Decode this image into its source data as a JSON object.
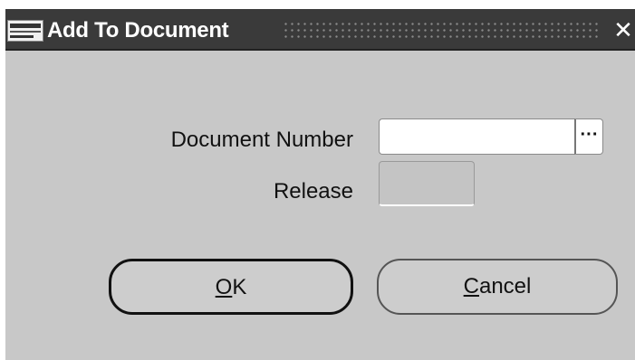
{
  "window": {
    "title": "Add To Document",
    "close_glyph": "✕"
  },
  "form": {
    "document_number_label": "Document Number",
    "document_number_value": "",
    "lov_button_glyph": "···",
    "release_label": "Release",
    "release_value": ""
  },
  "buttons": {
    "ok_accel": "O",
    "ok_rest": "K",
    "cancel_accel": "C",
    "cancel_rest": "ancel"
  },
  "icons": {
    "app": "oracle-app-icon",
    "close": "close-icon",
    "lov": "list-of-values-icon"
  },
  "colors": {
    "titlebar": "#3a3a3a",
    "window_bg": "#c8c8c8",
    "field_bg": "#ffffff"
  }
}
